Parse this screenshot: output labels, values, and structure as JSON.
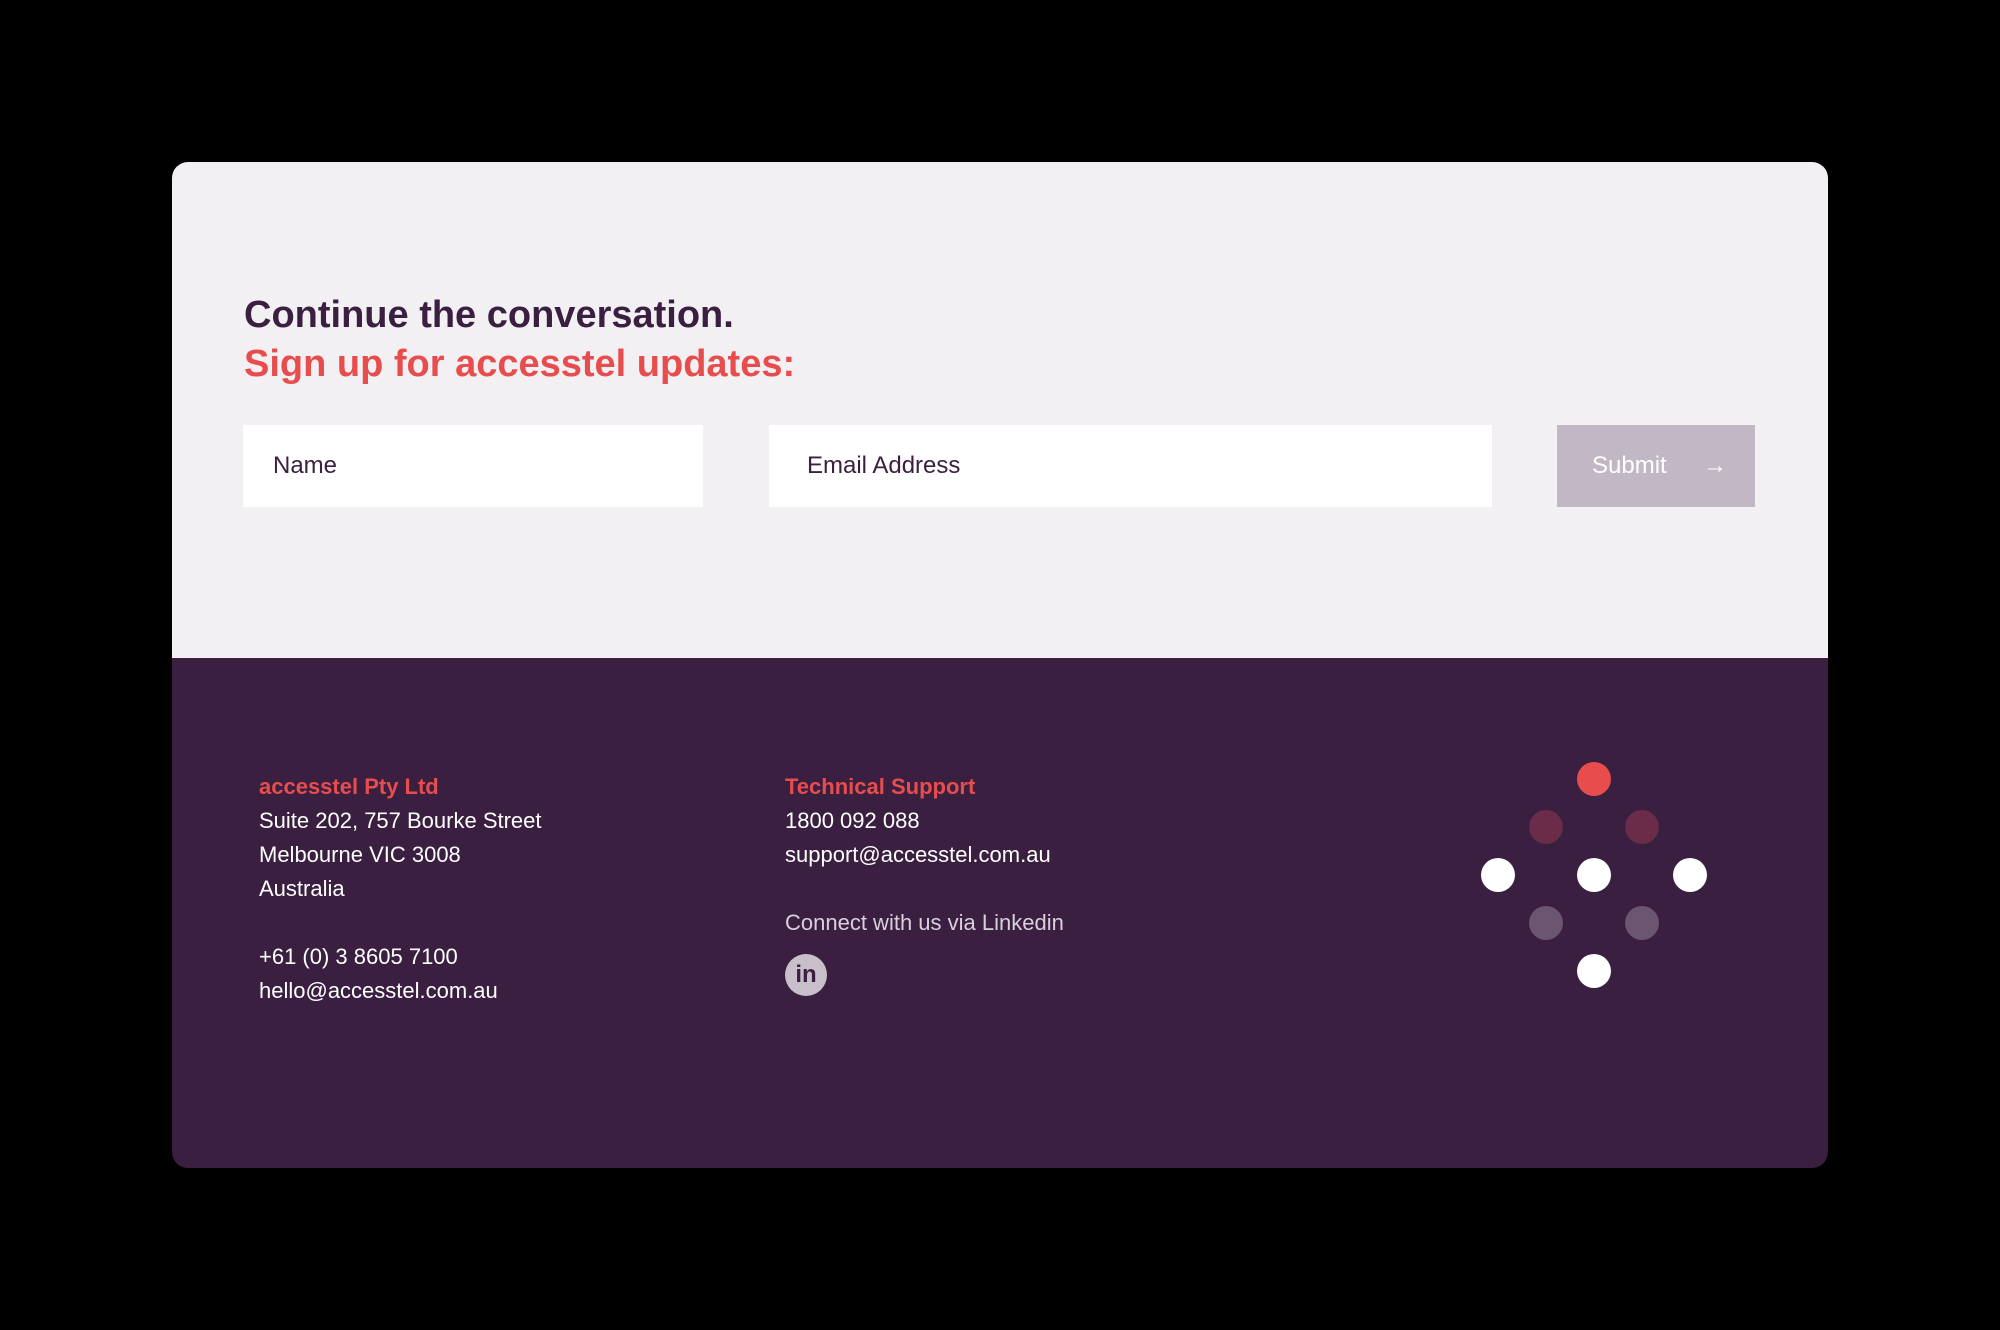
{
  "signup": {
    "heading_line1": "Continue the conversation.",
    "heading_line2": "Sign up for accesstel updates:",
    "name_placeholder": "Name",
    "email_placeholder": "Email Address",
    "submit_label": "Submit",
    "submit_arrow": "→"
  },
  "footer": {
    "company": {
      "label": "accesstel Pty Ltd",
      "address1": "Suite 202, 757 Bourke Street",
      "address2": "Melbourne VIC 3008",
      "address3": "Australia",
      "phone": "+61 (0) 3 8605 7100",
      "email": "hello@accesstel.com.au"
    },
    "support": {
      "label": "Technical Support",
      "phone": "1800 092 088",
      "email": "support@accesstel.com.au",
      "connect_text": "Connect with us via Linkedin",
      "linkedin_icon_text": "in"
    }
  },
  "colors": {
    "brand_purple": "#3a1f41",
    "brand_red": "#e84d4e",
    "panel_light": "#f2f0f3",
    "submit_disabled": "#c2b8c5"
  },
  "icons": {
    "arrow": "arrow-right-icon",
    "linkedin": "linkedin-icon",
    "logo": "dot-diamond-logo"
  }
}
